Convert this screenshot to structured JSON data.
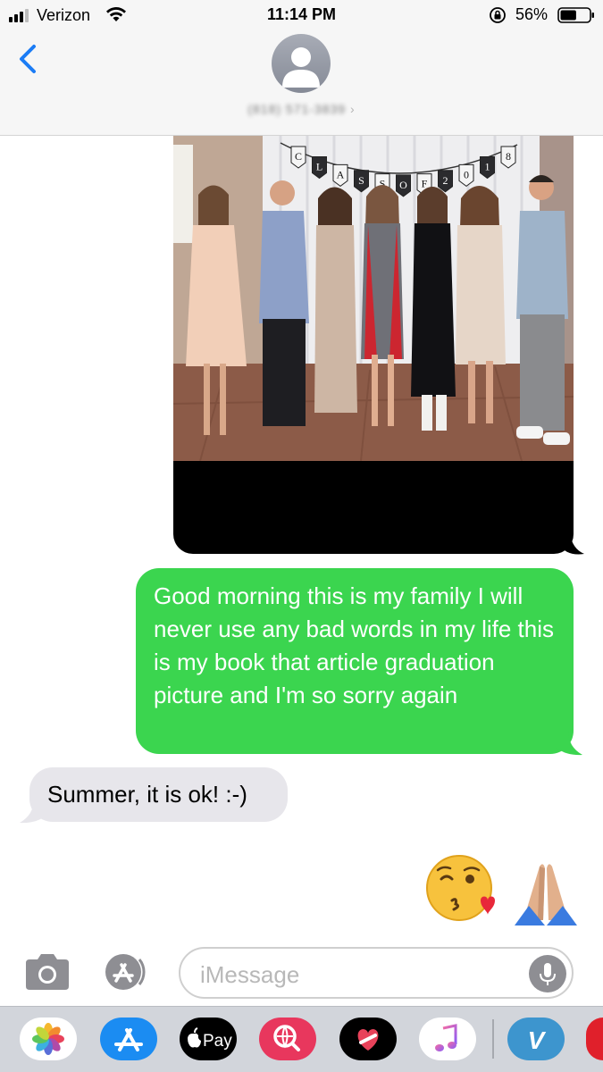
{
  "status_bar": {
    "carrier": "Verizon",
    "time": "11:14 PM",
    "battery_percent": "56%",
    "battery_level": 0.56
  },
  "header": {
    "contact_phone": "(818) 571-3839"
  },
  "messages": [
    {
      "type": "image",
      "direction": "outgoing"
    },
    {
      "type": "text",
      "direction": "outgoing",
      "text": "Good morning this is my family I will never use any bad words in my life this is my book that article graduation picture and I'm so sorry again"
    },
    {
      "type": "text",
      "direction": "incoming",
      "text": "Summer, it is ok!  :-)"
    },
    {
      "type": "emoji",
      "direction": "outgoing",
      "icons": [
        "kissing-face-icon",
        "folded-hands-icon"
      ]
    }
  ],
  "photo": {
    "banner_letters": [
      "C",
      "L",
      "A",
      "S",
      "S",
      "O",
      "F",
      "2",
      "0",
      "1",
      "8"
    ]
  },
  "input": {
    "placeholder": "iMessage"
  },
  "app_drawer": [
    {
      "name": "photos-app-icon"
    },
    {
      "name": "app-store-icon"
    },
    {
      "name": "apple-pay-icon",
      "label": "Pay"
    },
    {
      "name": "web-search-icon"
    },
    {
      "name": "digital-touch-icon"
    },
    {
      "name": "music-icon"
    },
    {
      "name": "venmo-icon",
      "label": "V"
    },
    {
      "name": "more-app-icon"
    }
  ],
  "colors": {
    "outgoing_bubble": "#3bd54f",
    "incoming_bubble": "#e7e6eb",
    "link_blue": "#1b7cf5"
  }
}
